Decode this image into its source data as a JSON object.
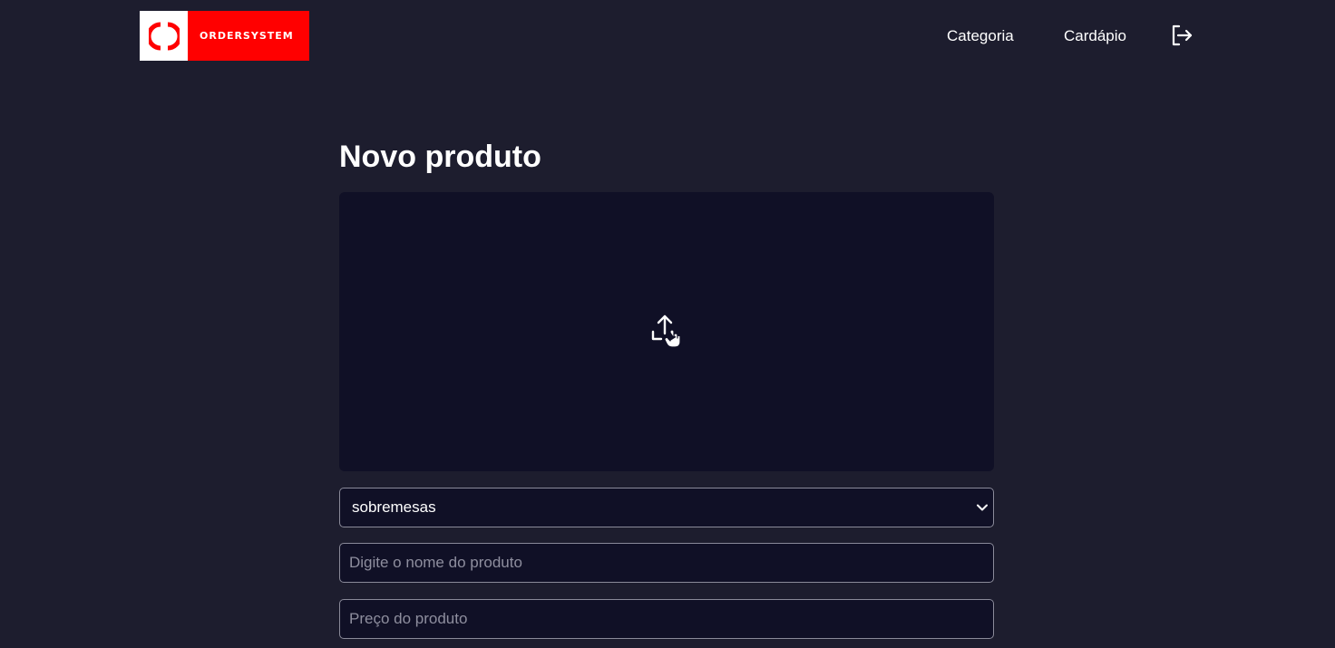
{
  "header": {
    "logo_text": "ORDERSYSTEM",
    "nav": [
      {
        "label": "Categoria"
      },
      {
        "label": "Cardápio"
      }
    ],
    "logout_icon": "logout-icon"
  },
  "main": {
    "title": "Novo produto",
    "upload_icon": "upload-icon",
    "category_select": {
      "selected": "sobremesas"
    },
    "name_input": {
      "value": "",
      "placeholder": "Digite o nome do produto"
    },
    "price_input": {
      "value": "",
      "placeholder": "Preço do produto"
    }
  },
  "colors": {
    "background": "#1d1d2e",
    "input_background": "#101026",
    "brand_red": "#ff0000",
    "text": "#ffffff"
  }
}
